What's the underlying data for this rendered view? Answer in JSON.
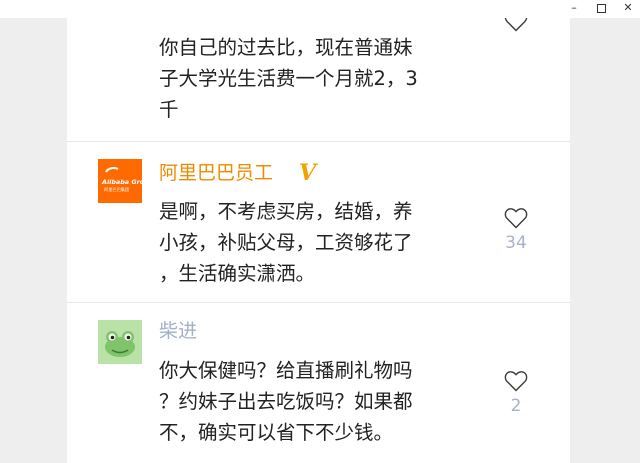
{
  "window": {
    "minimize_glyph": "–",
    "close_glyph": "✕"
  },
  "comments": [
    {
      "text_lines": [
        "你自己的过去比，现在普通妹",
        "子大学光生活费一个月就2，3",
        "千"
      ]
    },
    {
      "name": "阿里巴巴员工",
      "verified_badge": "V",
      "avatar_text": "Alibaba Group",
      "avatar_subtext": "阿里巴巴集团",
      "text_lines": [
        "是啊，不考虑买房，结婚，养",
        "小孩，补贴父母，工资够花了",
        "，生活确实潇洒。"
      ],
      "likes": "34",
      "name_color": "#f08a00",
      "avatar_color": "#ff6a00"
    },
    {
      "name": "柴进",
      "text_lines": [
        "你大保健吗？给直播刷礼物吗",
        "？约妹子出去吃饭吗？如果都",
        "不，确实可以省下不少钱。"
      ],
      "likes": "2",
      "name_color": "#a4b0c8",
      "avatar_color": "#b9e3a6"
    }
  ]
}
